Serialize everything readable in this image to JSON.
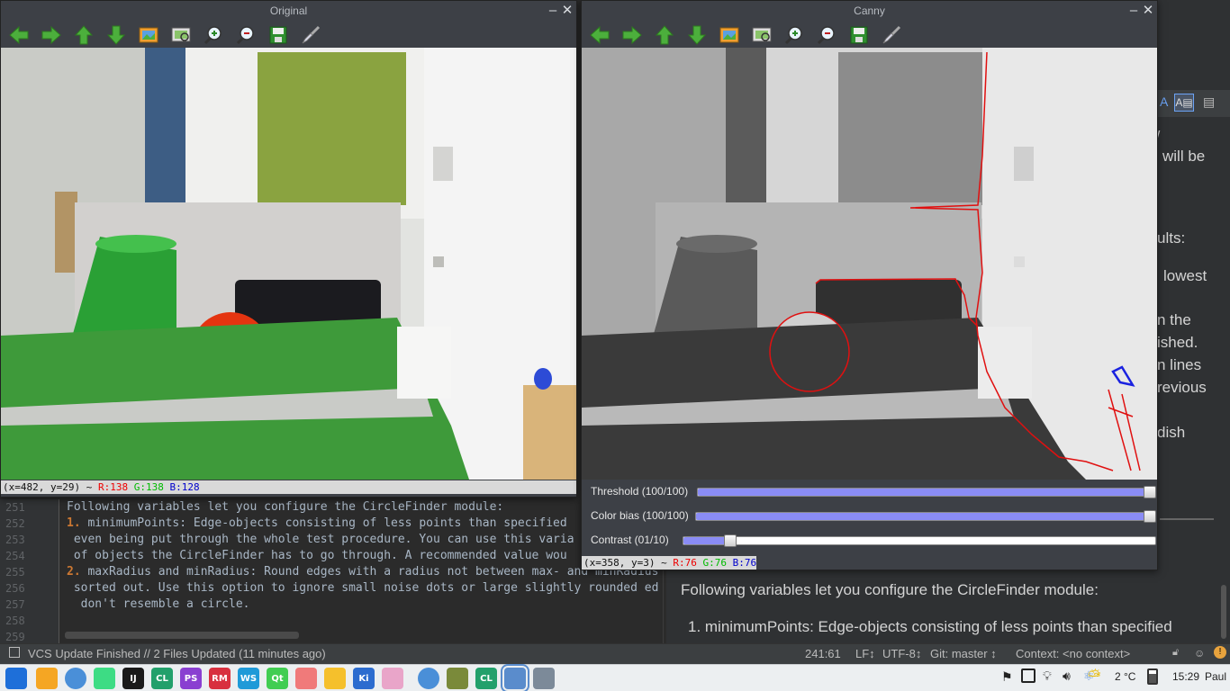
{
  "original_window": {
    "title": "Original",
    "pixel_info": {
      "coords": "(x=482, y=29) ~",
      "r": "R:138",
      "g": "G:138",
      "b": "B:128"
    }
  },
  "canny_window": {
    "title": "Canny",
    "pixel_info": {
      "coords": "(x=358, y=3) ~",
      "r": "R:76",
      "g": "G:76",
      "b": "B:76"
    },
    "trackbars": [
      {
        "label": "Threshold  (100/100)",
        "value": 1.0
      },
      {
        "label": "Color bias  (100/100)",
        "value": 1.0
      },
      {
        "label": "Contrast   (01/10)",
        "value": 0.1
      }
    ]
  },
  "window_buttons": {
    "minimize": "–",
    "close": "✕"
  },
  "toolbar_icons": [
    "arrow-left-icon",
    "arrow-right-icon",
    "arrow-up-icon",
    "arrow-down-icon",
    "image-icon",
    "fit-window-icon",
    "zoom-in-icon",
    "zoom-out-icon",
    "save-icon",
    "brush-icon"
  ],
  "editor": {
    "lines": [
      {
        "n": "251",
        "text": "Following variables let you configure the CircleFinder module:"
      },
      {
        "n": "252",
        "bold": "1.",
        "text": " minimumPoints: Edge-objects consisting of less points than specified"
      },
      {
        "n": "253",
        "text": " even being put through the whole test procedure. You can use this varia"
      },
      {
        "n": "254",
        "text": " of objects the CircleFinder has to go through. A recommended value wou"
      },
      {
        "n": "255",
        "bold": "2.",
        "text": " maxRadius and minRadius: Round edges with a radius not between max- and minRadius"
      },
      {
        "n": "256",
        "text": " sorted out. Use this option to ignore small noise dots or large slightly rounded ed"
      },
      {
        "n": "257",
        "text": "  don't resemble a circle."
      },
      {
        "n": "258",
        "text": ""
      },
      {
        "n": "259",
        "text": ""
      }
    ]
  },
  "preview": {
    "fragments": [
      "w",
      "will be",
      "ults:",
      "lowest",
      "n the",
      "ished.",
      "n lines",
      "revious",
      "dish"
    ],
    "heading": "Following variables let you configure the CircleFinder module:",
    "list_item": "1.  minimumPoints: Edge-objects consisting of less points than specified"
  },
  "statusbar": {
    "vcs": "VCS Update Finished // 2 Files Updated (11 minutes ago)",
    "position": "241:61",
    "line_sep": "LF↕",
    "encoding": "UTF-8↕",
    "git": "Git: master ↕",
    "context": "Context: <no context>"
  },
  "taskbar": {
    "apps": [
      {
        "name": "launcher-icon",
        "label": "",
        "color": "#1e6fd9"
      },
      {
        "name": "files-icon",
        "label": "",
        "color": "#f5a623"
      },
      {
        "name": "chromium-icon",
        "label": "",
        "color": "#4a8fd8"
      },
      {
        "name": "android-studio-icon",
        "label": "",
        "color": "#3ddc84"
      },
      {
        "name": "intellij-icon",
        "label": "IJ",
        "color": "#1a1a1a"
      },
      {
        "name": "clion-icon",
        "label": "CL",
        "color": "#22a06b"
      },
      {
        "name": "phpstorm-icon",
        "label": "PS",
        "color": "#8a3fd1"
      },
      {
        "name": "rubymine-icon",
        "label": "RM",
        "color": "#d8303f"
      },
      {
        "name": "webstorm-icon",
        "label": "WS",
        "color": "#1f9ad8"
      },
      {
        "name": "qt-icon",
        "label": "Qt",
        "color": "#41cd52"
      },
      {
        "name": "app-gear-icon",
        "label": "",
        "color": "#f07a7a"
      },
      {
        "name": "app-yellow-icon",
        "label": "",
        "color": "#f5c02c"
      },
      {
        "name": "krita-icon",
        "label": "Ki",
        "color": "#2c6ccf"
      },
      {
        "name": "app-pink-icon",
        "label": "",
        "color": "#e9a5c9"
      },
      {
        "name": "chromium-2-icon",
        "label": "",
        "color": "#4a8fd8"
      },
      {
        "name": "music-icon",
        "label": "",
        "color": "#7a8a3a"
      },
      {
        "name": "clion-2-icon",
        "label": "CL",
        "color": "#22a06b"
      },
      {
        "name": "window-1-icon",
        "label": "",
        "color": "#5a8ccc"
      },
      {
        "name": "window-2-icon",
        "label": "",
        "color": "#7c8a99"
      }
    ],
    "temperature": "2 °C",
    "time": "15:29",
    "user": "Paul"
  }
}
